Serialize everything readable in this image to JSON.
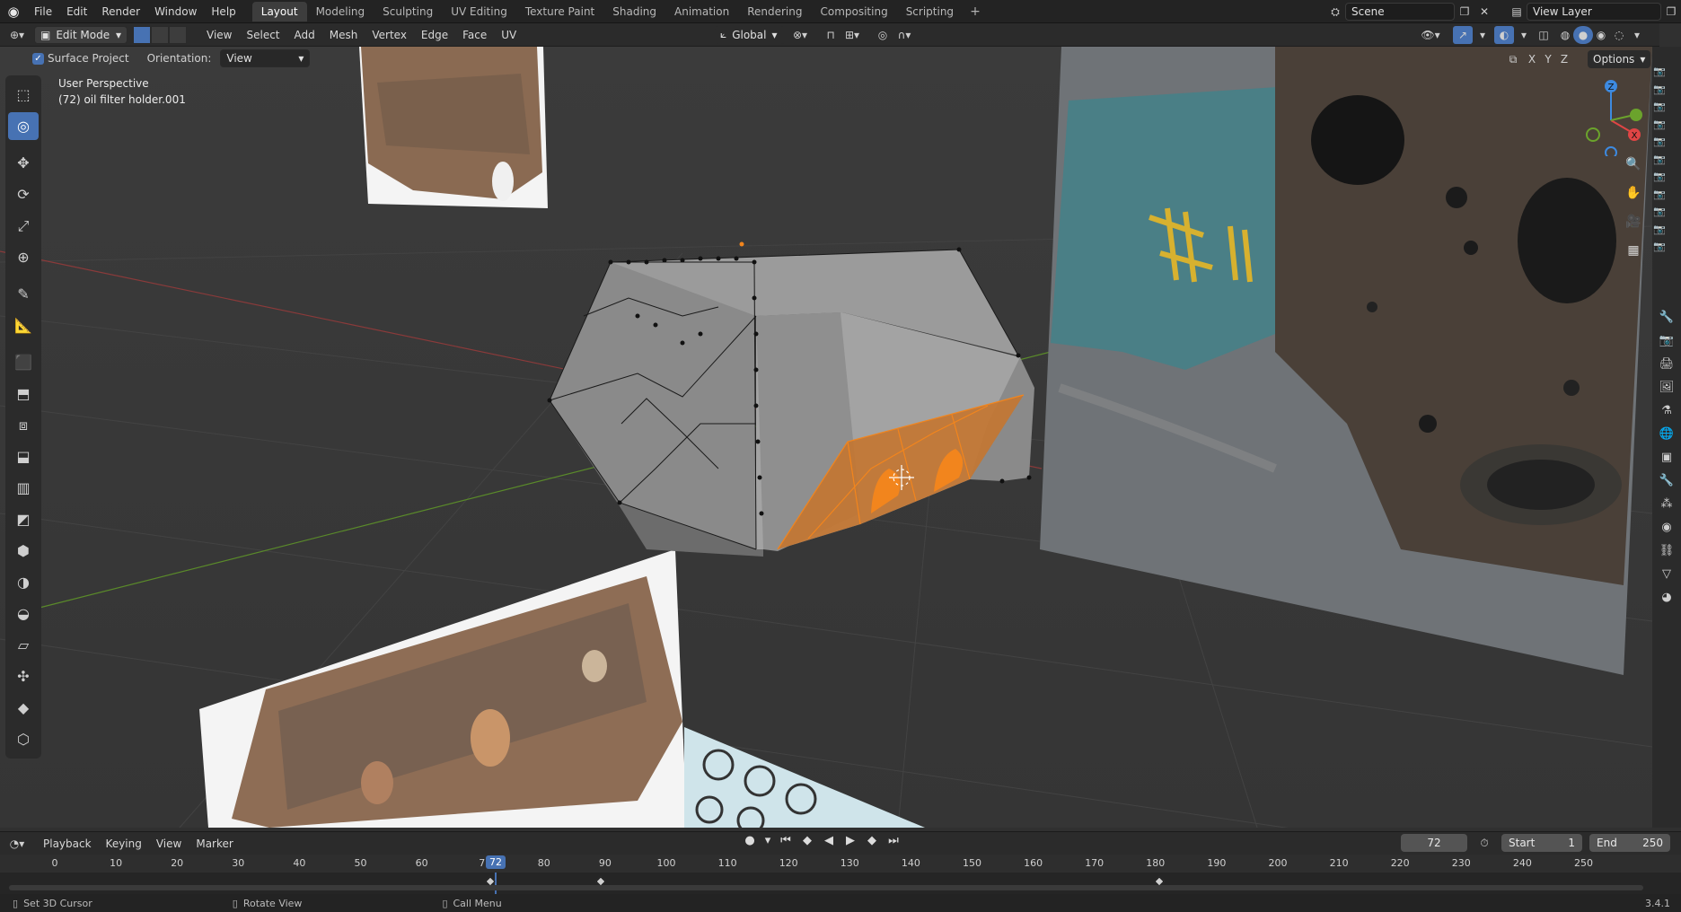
{
  "topbar": {
    "menu": [
      "File",
      "Edit",
      "Render",
      "Window",
      "Help"
    ],
    "workspaces": [
      "Layout",
      "Modeling",
      "Sculpting",
      "UV Editing",
      "Texture Paint",
      "Shading",
      "Animation",
      "Rendering",
      "Compositing",
      "Scripting"
    ],
    "active_workspace": "Layout",
    "scene": "Scene",
    "view_layer": "View Layer"
  },
  "header": {
    "mode": "Edit Mode",
    "menu": [
      "View",
      "Select",
      "Add",
      "Mesh",
      "Vertex",
      "Edge",
      "Face",
      "UV"
    ],
    "orientation": "Global"
  },
  "tool_settings": {
    "surface_project_label": "Surface Project",
    "orientation_label": "Orientation:",
    "orientation_value": "View",
    "options_label": "Options",
    "axes": [
      "X",
      "Y",
      "Z"
    ]
  },
  "viewport": {
    "view_name": "User Perspective",
    "object_info": "(72) oil filter holder.001"
  },
  "gizmo": {
    "z": "Z",
    "x": "X"
  },
  "timeline": {
    "menu": [
      "Playback",
      "Keying",
      "View",
      "Marker"
    ],
    "current_frame": "72",
    "start_label": "Start",
    "start": "1",
    "end_label": "End",
    "end": "250",
    "ticks": [
      "0",
      "10",
      "20",
      "30",
      "40",
      "50",
      "60",
      "7",
      "80",
      "90",
      "100",
      "110",
      "120",
      "130",
      "140",
      "150",
      "160",
      "170",
      "180",
      "190",
      "200",
      "210",
      "220",
      "230",
      "240",
      "250"
    ],
    "playhead": "72"
  },
  "statusbar": {
    "left": "Set 3D Cursor",
    "middle": "Rotate View",
    "right": "Call Menu",
    "version": "3.4.1"
  },
  "colors": {
    "accent": "#4772b3",
    "selection": "#f2851d"
  }
}
